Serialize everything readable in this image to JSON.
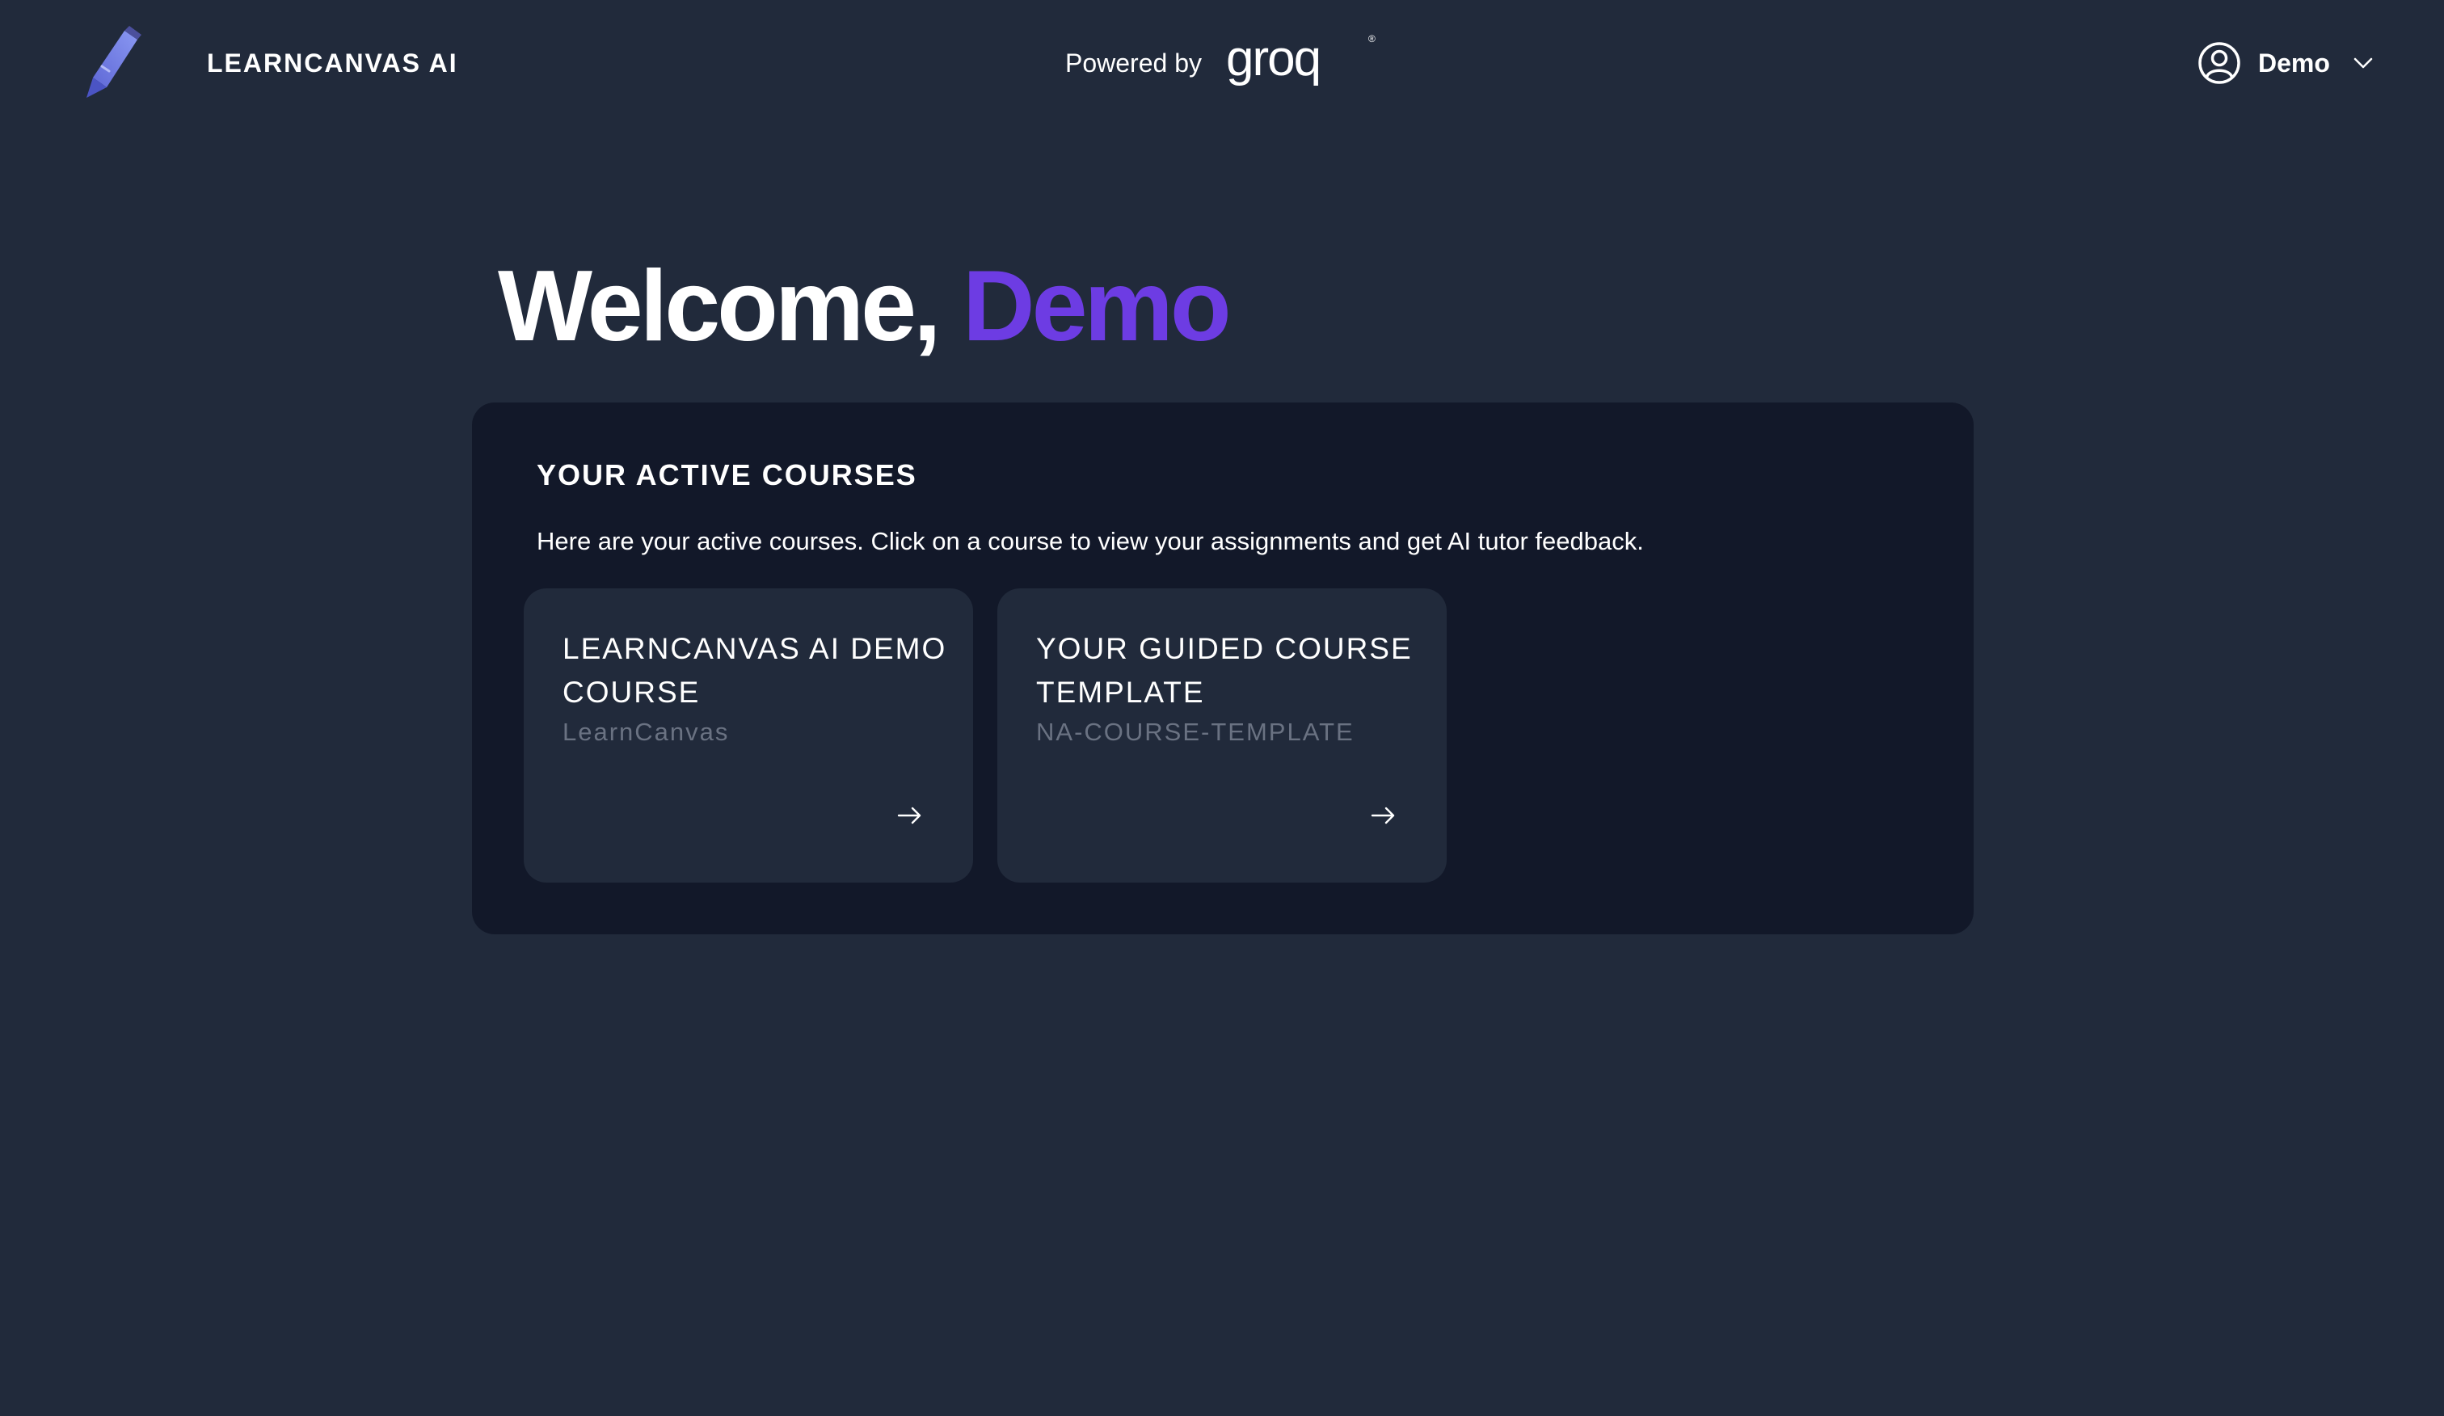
{
  "header": {
    "logo_icon": "pencil-icon",
    "brand": "LEARNCANVAS AI",
    "powered_label": "Powered by",
    "powered_logo_text": "groq",
    "user_icon": "user-circle-icon",
    "user_name": "Demo",
    "dropdown_icon": "chevron-down-icon"
  },
  "welcome": {
    "greeting": "Welcome,",
    "name": "Demo"
  },
  "courses_panel": {
    "title": "YOUR ACTIVE COURSES",
    "description": "Here are your active courses. Click on a course to view your assignments and get AI tutor feedback.",
    "courses": [
      {
        "title": "LEARNCANVAS AI DEMO COURSE",
        "code": "LearnCanvas",
        "icon": "arrow-right-icon"
      },
      {
        "title": "YOUR GUIDED COURSE TEMPLATE",
        "code": "NA-COURSE-TEMPLATE",
        "icon": "arrow-right-icon"
      }
    ]
  },
  "colors": {
    "background": "#212a3b",
    "panel": "#121829",
    "card": "#212a3b",
    "accent": "#6d3ce3",
    "muted_text": "#6a7282",
    "logo_blue": "#6f7fe8"
  }
}
